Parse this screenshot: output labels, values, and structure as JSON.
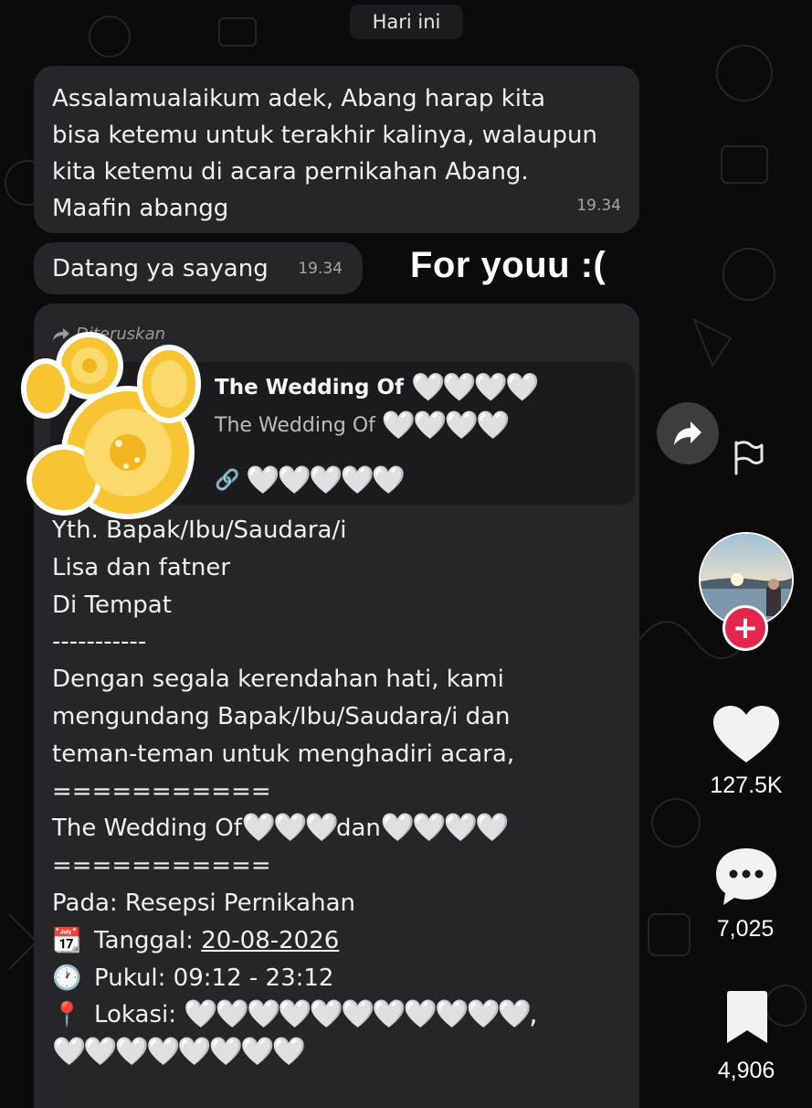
{
  "chat": {
    "date_label": "Hari ini",
    "messages": [
      {
        "text": "Assalamualaikum adek, Abang harap kita bisa ketemu untuk terakhir kalinya, walaupun kita ketemu di acara pernikahan Abang. Maafin abangg",
        "lines": [
          "Assalamualaikum adek, Abang harap kita",
          "bisa ketemu untuk terakhir kalinya, walaupun",
          "kita ketemu di acara pernikahan Abang.",
          "Maafin abangg"
        ],
        "time": "19.34"
      },
      {
        "text": "Datang ya sayang",
        "time": "19.34"
      }
    ],
    "forwarded": {
      "label": "Diteruskan",
      "preview_title": "The Wedding Of",
      "preview_subtitle": "The Wedding Of",
      "lines": [
        "Yth. Bapak/Ibu/Saudara/i",
        "Lisa dan fatner",
        "Di Tempat",
        "-----------",
        "Dengan segala kerendahan hati, kami",
        "mengundang Bapak/Ibu/Saudara/i dan",
        "teman-teman untuk menghadiri acara,",
        "===========",
        "The Wedding Of",
        "===========",
        "Pada: Resepsi Pernikahan"
      ],
      "wedding_connector": "dan",
      "date_label": "Tanggal:",
      "date_value": "20-08-2026",
      "time_label": "Pukul: 09:12 - 23:12",
      "location_label": "Lokasi:"
    }
  },
  "overlay_caption": "For youu :(",
  "rail": {
    "likes": "127.5K",
    "comments": "7,025",
    "saves": "4,906",
    "like_color": "#f2f2f2",
    "follow_color": "#e3264c"
  },
  "icons": {
    "share": "share-arrow-icon",
    "flag": "flag-icon",
    "like": "heart-icon",
    "comment": "comment-bubble-icon",
    "save": "bookmark-icon",
    "calendar": "calendar-emoji",
    "clock": "clock-emoji",
    "pin": "pin-emoji"
  }
}
